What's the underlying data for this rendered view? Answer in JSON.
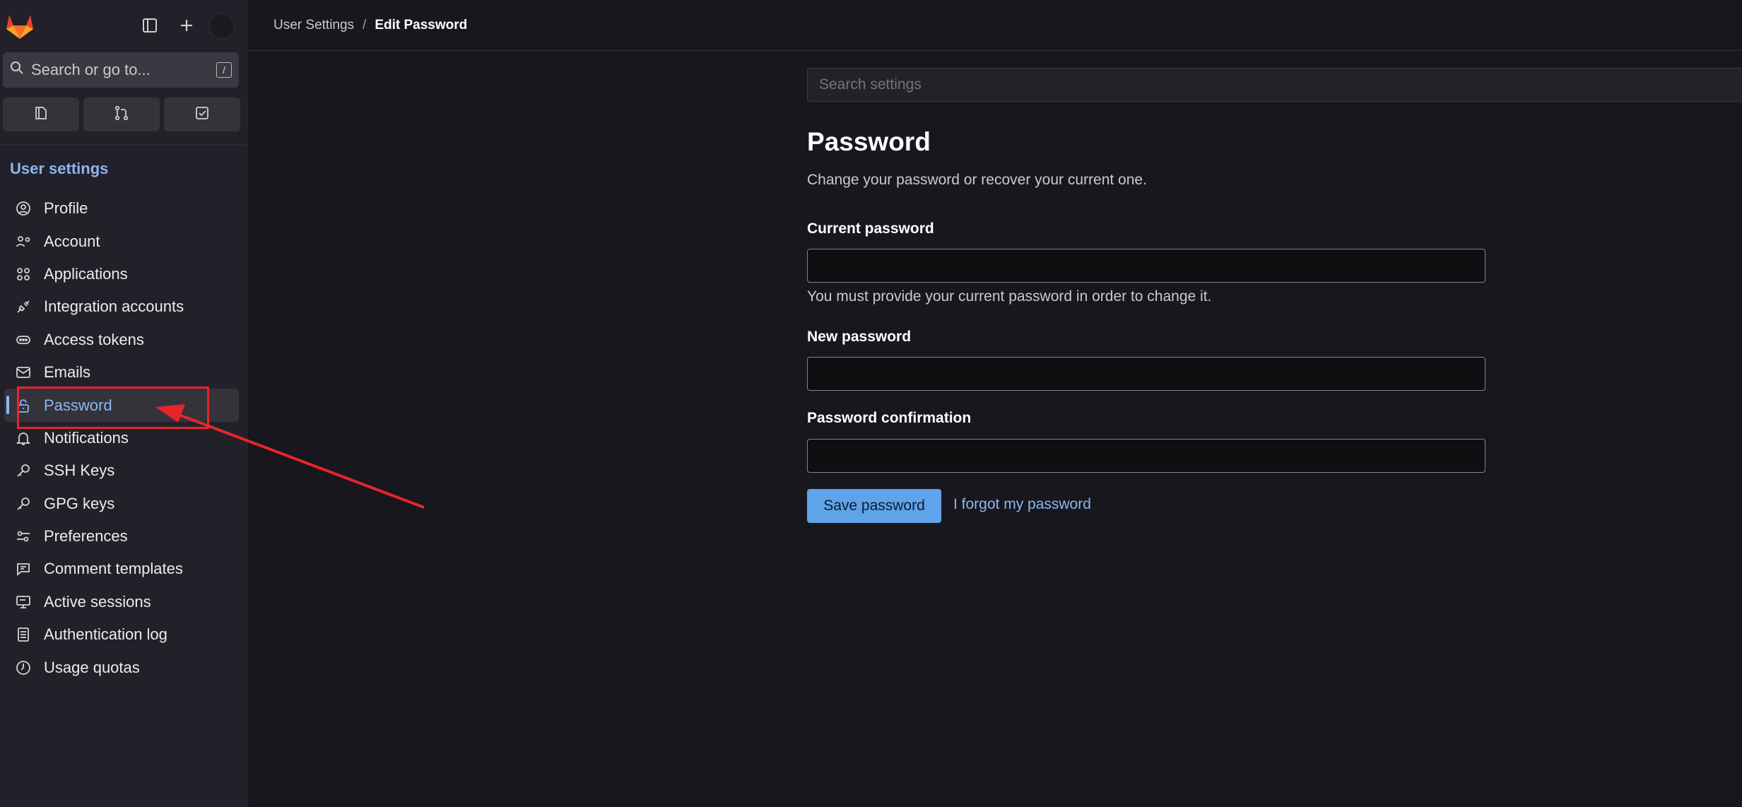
{
  "sidebar": {
    "search_placeholder": "Search or go to...",
    "search_shortcut": "/",
    "section_title": "User settings",
    "items": [
      {
        "label": "Profile",
        "icon": "profile-icon"
      },
      {
        "label": "Account",
        "icon": "account-icon"
      },
      {
        "label": "Applications",
        "icon": "applications-icon"
      },
      {
        "label": "Integration accounts",
        "icon": "integration-icon"
      },
      {
        "label": "Access tokens",
        "icon": "token-icon"
      },
      {
        "label": "Emails",
        "icon": "mail-icon"
      },
      {
        "label": "Password",
        "icon": "lock-icon",
        "active": true
      },
      {
        "label": "Notifications",
        "icon": "bell-icon"
      },
      {
        "label": "SSH Keys",
        "icon": "key-icon"
      },
      {
        "label": "GPG keys",
        "icon": "key-icon"
      },
      {
        "label": "Preferences",
        "icon": "preferences-icon"
      },
      {
        "label": "Comment templates",
        "icon": "comment-icon"
      },
      {
        "label": "Active sessions",
        "icon": "monitor-icon"
      },
      {
        "label": "Authentication log",
        "icon": "log-icon"
      },
      {
        "label": "Usage quotas",
        "icon": "quota-icon"
      }
    ]
  },
  "breadcrumb": {
    "parent": "User Settings",
    "separator": "/",
    "current": "Edit Password"
  },
  "main": {
    "search_placeholder": "Search settings",
    "title": "Password",
    "description": "Change your password or recover your current one.",
    "current_password_label": "Current password",
    "current_password_help": "You must provide your current password in order to change it.",
    "new_password_label": "New password",
    "confirmation_label": "Password confirmation",
    "save_button": "Save password",
    "forgot_link": "I forgot my password"
  },
  "colors": {
    "background": "#18171d",
    "sidebar": "#222129",
    "accent": "#8cb6f2",
    "primary_button": "#5fa4ea",
    "annotation": "#e4262b"
  }
}
